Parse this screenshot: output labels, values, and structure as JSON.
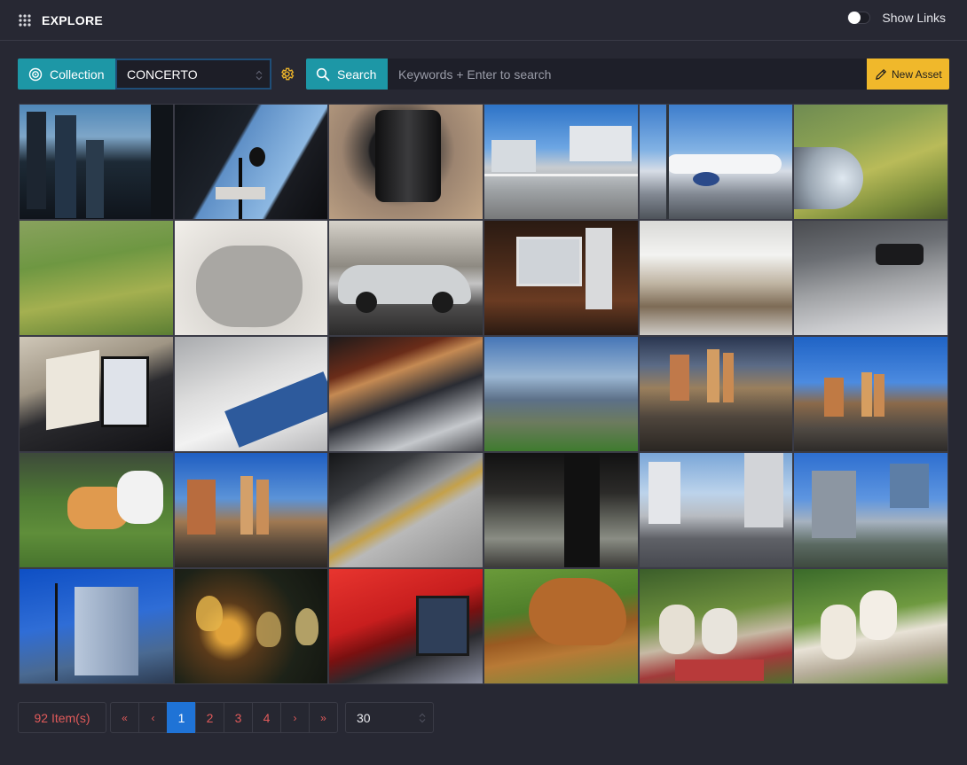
{
  "header": {
    "title": "EXPLORE",
    "icon": "grid-dots-icon",
    "show_links_label": "Show Links",
    "show_links_on": false
  },
  "toolbar": {
    "collection_label": "Collection",
    "collection_value": "CONCERTO",
    "search_label": "Search",
    "search_placeholder": "Keywords + Enter to search",
    "search_value": "",
    "new_asset_label": "New Asset",
    "accent_color": "#1d97a6",
    "new_asset_color": "#f0b82b"
  },
  "grid": {
    "tiles": [
      {
        "subject": "city-skyscrapers"
      },
      {
        "subject": "street-lamp-buildings"
      },
      {
        "subject": "camera-lens"
      },
      {
        "subject": "balcony-apartments"
      },
      {
        "subject": "airplane-tarmac"
      },
      {
        "subject": "aerial-engine-fields"
      },
      {
        "subject": "aerial-rice-fields"
      },
      {
        "subject": "fabric-speaker"
      },
      {
        "subject": "silver-sedan"
      },
      {
        "subject": "desktop-computer"
      },
      {
        "subject": "piano-keys-blur"
      },
      {
        "subject": "device-closeup"
      },
      {
        "subject": "sheet-music-tablet"
      },
      {
        "subject": "sheet-music-closeup"
      },
      {
        "subject": "tablet-sheet-music"
      },
      {
        "subject": "lake-mountains"
      },
      {
        "subject": "city-towers-sunset"
      },
      {
        "subject": "city-towers-blue-sky"
      },
      {
        "subject": "corgi-on-grass"
      },
      {
        "subject": "twin-towers"
      },
      {
        "subject": "train-platform"
      },
      {
        "subject": "dark-interior"
      },
      {
        "subject": "metro-track-street"
      },
      {
        "subject": "construction-towers"
      },
      {
        "subject": "office-tower"
      },
      {
        "subject": "light-installation"
      },
      {
        "subject": "red-computer"
      },
      {
        "subject": "golden-dog"
      },
      {
        "subject": "french-bulldogs-picnic"
      },
      {
        "subject": "french-bulldog-grass"
      }
    ]
  },
  "pagination": {
    "count_label": "92 Item(s)",
    "first": "«",
    "prev": "‹",
    "pages": [
      "1",
      "2",
      "3",
      "4"
    ],
    "current_page": "1",
    "next": "›",
    "last": "»",
    "per_page": "30",
    "count_color": "#e05a5a",
    "active_color": "#1f73d6"
  }
}
